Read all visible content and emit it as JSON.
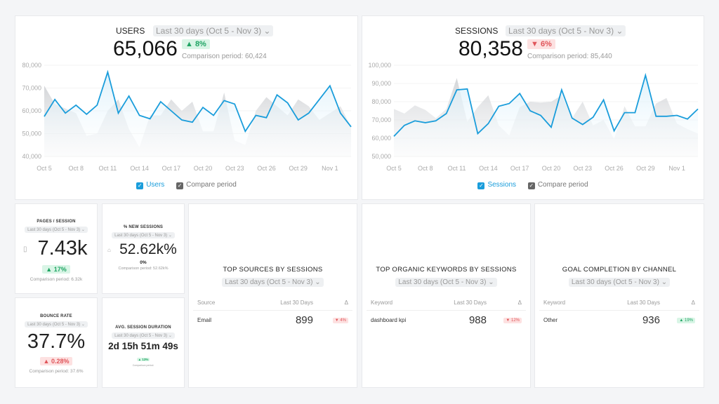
{
  "period": "Last 30 days (Oct 5 - Nov 3)",
  "colors": {
    "accent": "#1a9ddb",
    "compare": "#d8d9db",
    "up": "#1fa463",
    "down": "#e0555a"
  },
  "users": {
    "title": "USERS",
    "value": "65,066",
    "change": "▲ 8%",
    "change_dir": "up",
    "comparison": "Comparison period: 60,424",
    "legend_main": "Users",
    "legend_compare": "Compare period"
  },
  "sessions": {
    "title": "SESSIONS",
    "value": "80,358",
    "change": "▼ 6%",
    "change_dir": "down",
    "comparison": "Comparison period: 85,440",
    "legend_main": "Sessions",
    "legend_compare": "Compare period"
  },
  "chart_data": [
    {
      "type": "area",
      "title": "USERS",
      "ylim": [
        40000,
        80000
      ],
      "yticks": [
        "80,000",
        "70,000",
        "60,000",
        "50,000",
        "40,000"
      ],
      "xticks": [
        "Oct 5",
        "Oct 8",
        "Oct 11",
        "Oct 14",
        "Oct 17",
        "Oct 20",
        "Oct 23",
        "Oct 26",
        "Oct 29",
        "Nov 1"
      ],
      "series": [
        {
          "name": "Users",
          "values": [
            57500,
            65000,
            59000,
            62500,
            58500,
            62500,
            77000,
            59000,
            66500,
            58000,
            56500,
            64000,
            60000,
            56000,
            55000,
            61500,
            58000,
            64500,
            63000,
            51000,
            58000,
            57000,
            67000,
            63500,
            56000,
            59000,
            65000,
            71000,
            59000,
            53000
          ]
        },
        {
          "name": "Compare period",
          "values": [
            71000,
            63000,
            61000,
            59000,
            49000,
            50000,
            60000,
            65000,
            52000,
            44000,
            58000,
            58000,
            65000,
            60000,
            64000,
            51000,
            51000,
            68000,
            47000,
            45000,
            60000,
            66000,
            62000,
            58000,
            65000,
            62000,
            56000,
            59000,
            62000,
            53000
          ]
        }
      ]
    },
    {
      "type": "area",
      "title": "SESSIONS",
      "ylim": [
        50000,
        100000
      ],
      "yticks": [
        "100,000",
        "90,000",
        "80,000",
        "70,000",
        "60,000",
        "50,000"
      ],
      "xticks": [
        "Oct 5",
        "Oct 8",
        "Oct 11",
        "Oct 14",
        "Oct 17",
        "Oct 20",
        "Oct 23",
        "Oct 26",
        "Oct 29",
        "Nov 1"
      ],
      "series": [
        {
          "name": "Sessions",
          "values": [
            61000,
            67000,
            69500,
            68500,
            69500,
            73500,
            86500,
            87000,
            62500,
            68000,
            77500,
            79000,
            84500,
            75000,
            72500,
            66000,
            86500,
            71000,
            67500,
            71500,
            81000,
            64000,
            74000,
            74000,
            94500,
            72000,
            72000,
            72500,
            70500,
            76000
          ]
        },
        {
          "name": "Compare period",
          "values": [
            76000,
            73500,
            78000,
            75500,
            71000,
            76000,
            93000,
            69000,
            77000,
            83500,
            67000,
            61500,
            77000,
            80000,
            79500,
            80000,
            83500,
            71000,
            80000,
            67000,
            70000,
            59500,
            77500,
            66500,
            66500,
            79000,
            82000,
            68000,
            65000,
            62500
          ]
        }
      ]
    }
  ],
  "kpis": {
    "pages": {
      "title": "PAGES / SESSION",
      "value": "7.43k",
      "change": "▲ 17%",
      "comparison": "Comparison period: 6.32k"
    },
    "new_sessions": {
      "title": "% NEW SESSIONS",
      "value": "52.62k%",
      "change": "0%",
      "comparison": "Comparison period: 52.62k%"
    },
    "bounce": {
      "title": "BOUNCE RATE",
      "value": "37.7%",
      "change": "▲ 0.28%",
      "comparison": "Comparison period: 37.6%"
    },
    "duration": {
      "title": "AVG. SESSION DURATION",
      "value": "2d 15h 51m 49s",
      "change": "▲ 13%",
      "comparison": "Comparison period:"
    }
  },
  "tables": [
    {
      "title": "TOP SOURCES BY SESSIONS",
      "cols": [
        "Source",
        "Last 30 Days",
        "Δ"
      ],
      "row": {
        "label": "Email",
        "value": "899",
        "change": "▼ 4%",
        "dir": "down"
      }
    },
    {
      "title": "TOP ORGANIC KEYWORDS BY SESSIONS",
      "cols": [
        "Keyword",
        "Last 30 Days",
        "Δ"
      ],
      "row": {
        "label": "dashboard kpi",
        "value": "988",
        "change": "▼ 12%",
        "dir": "down"
      }
    },
    {
      "title": "GOAL COMPLETION BY CHANNEL",
      "cols": [
        "Keyword",
        "Last 30 Days",
        "Δ"
      ],
      "row": {
        "label": "Other",
        "value": "936",
        "change": "▲ 19%",
        "dir": "up"
      }
    }
  ]
}
